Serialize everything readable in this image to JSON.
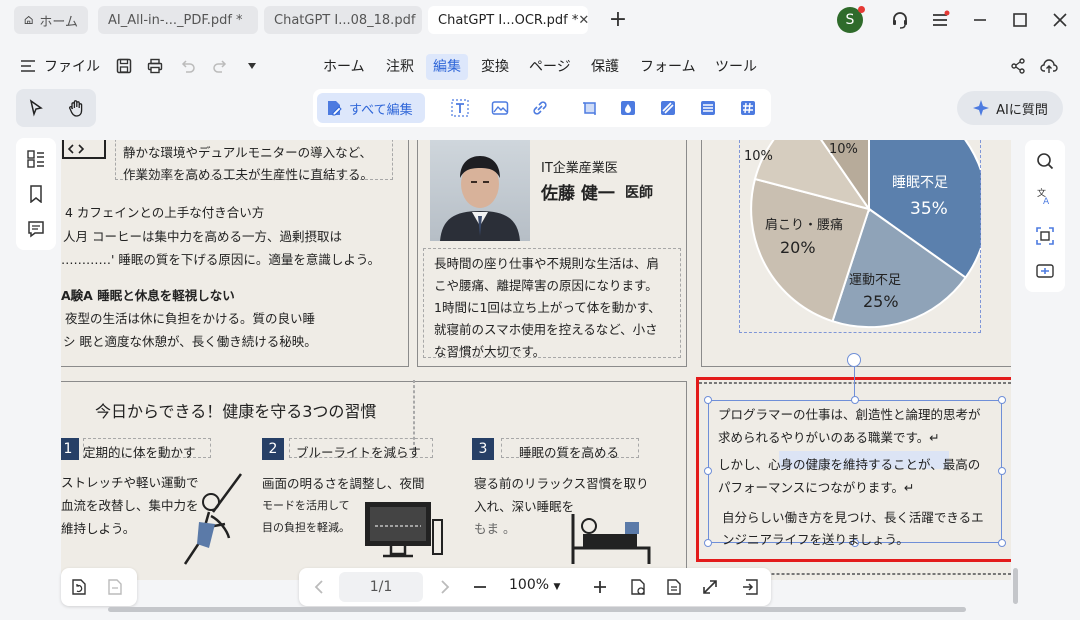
{
  "tabs": [
    {
      "label": "ホーム",
      "closable": false
    },
    {
      "label": "AI_All-in-..._PDF.pdf *",
      "closable": false
    },
    {
      "label": "ChatGPT I...08_18.pdf",
      "closable": false
    },
    {
      "label": "ChatGPT I...OCR.pdf *",
      "closable": true,
      "active": true
    }
  ],
  "user": {
    "initial": "S"
  },
  "menu": {
    "file_label": "ファイル",
    "items": [
      "ホーム",
      "注釈",
      "編集",
      "変換",
      "ページ",
      "保護",
      "フォーム",
      "ツール"
    ],
    "active": "編集"
  },
  "toolbar": {
    "edit_all_label": "すべて編集",
    "ai_label": "AIに質問"
  },
  "document": {
    "left_col": {
      "l1": "静かな環境やデュアルモニターの導入など、",
      "l2": "作業効率を高める工夫が生産性に直結する。",
      "h4": "4 カフェインとの上手な付き合い方",
      "l3": "人月 コーヒーは集中力を高める一方、過剰摂取は",
      "l4": "…………' 睡眠の質を下げる原因に。適量を意識しよう。",
      "h5": "A験A 睡眠と休息を軽視しない",
      "l5": "夜型の生活は休に負担をかける。質の良い睡",
      "l6": "シ 眠と適度な休憩が、長く働き続ける秘映。"
    },
    "doctor": {
      "affiliation": "IT企業産業医",
      "name": "佐藤 健一",
      "title": "医師",
      "l1": "長時間の座り仕事や不規則な生活は、肩",
      "l2": "こや腰痛、離提障害の原因になります。",
      "l3": "1時間に1回は立ち上がって体を動かす、",
      "l4": "就寝前のスマホ使用を控えるなど、小さ",
      "l5": "な習慣が大切です。"
    },
    "pie": {
      "labels": [
        {
          "text": "睡眠不足",
          "value": "35%"
        },
        {
          "text": "運動不足",
          "value": "25%"
        },
        {
          "text": "肩こり・腰痛",
          "value": "20%"
        },
        {
          "text": "",
          "value": "10%"
        },
        {
          "text": "",
          "value": "10%"
        }
      ]
    },
    "habits": {
      "heading": "今日からできる！健康を守る3つの習慣",
      "items": [
        {
          "num": "1",
          "title": "定期的に体を動かす",
          "l1": "ストレッチや軽い運動で",
          "l2": "血流を改替し、集中力を",
          "l3": "維持しよう。"
        },
        {
          "num": "2",
          "title": "ブルーライトを減らす",
          "l1": "画面の明るさを調整し、夜間",
          "l2": "モードを活用して",
          "l3": "目の負担を軽減。"
        },
        {
          "num": "3",
          "title": "睡眠の質を高める",
          "l1": "寝る前のリラックス習慣を取り",
          "l2": "入れ、深い睡眠を",
          "l3": "もま 。"
        }
      ]
    },
    "selected_text": {
      "l1": "プログラマーの仕事は、創造性と論理的思考が",
      "l2": "求められるやりがいのある職業です。↵",
      "l3": "しかし、心身の健康を維持することが、最高の",
      "l4": "パフォーマンスにつながります。↵",
      "l5": "自分らしい働き方を見つけ、長く活躍できるエ",
      "l6": "ンジニアライフを送りましょう。"
    }
  },
  "bottom": {
    "page": "1/1",
    "zoom": "100%"
  },
  "colors": {
    "accent": "#2f66d8",
    "selection_red": "#e31b1b",
    "pie_blue": "#5b80ad"
  }
}
